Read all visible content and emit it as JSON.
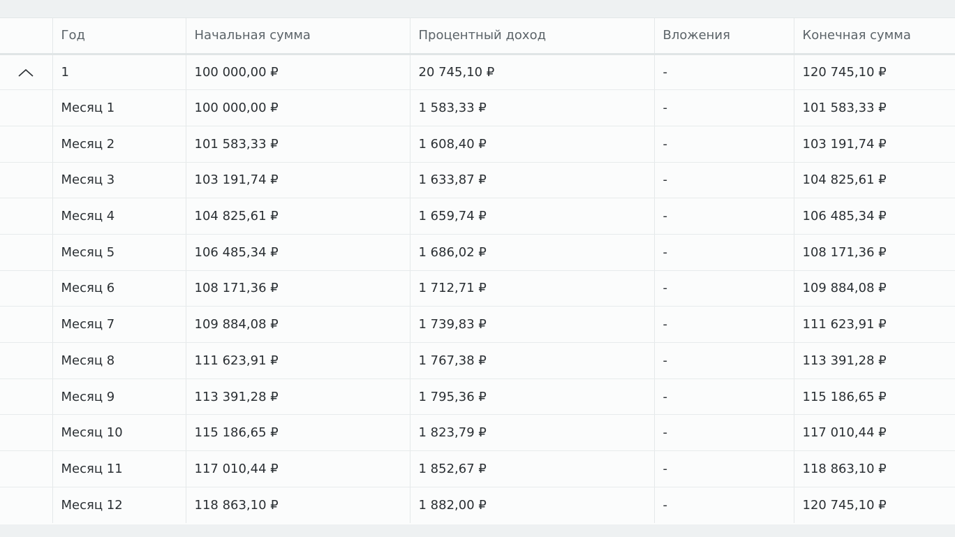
{
  "table": {
    "headers": [
      "",
      "Год",
      "Начальная сумма",
      "Процентный доход",
      "Вложения",
      "Конечная сумма"
    ],
    "year_row": {
      "year": "1",
      "start": "100 000,00 ₽",
      "interest": "20 745,10 ₽",
      "deposits": "-",
      "end": "120 745,10 ₽",
      "toggle_icon": "chevron-up-icon"
    },
    "months": [
      {
        "label": "Месяц 1",
        "start": "100 000,00 ₽",
        "interest": "1 583,33 ₽",
        "deposits": "-",
        "end": "101 583,33 ₽"
      },
      {
        "label": "Месяц 2",
        "start": "101 583,33 ₽",
        "interest": "1 608,40 ₽",
        "deposits": "-",
        "end": "103 191,74 ₽"
      },
      {
        "label": "Месяц 3",
        "start": "103 191,74 ₽",
        "interest": "1 633,87 ₽",
        "deposits": "-",
        "end": "104 825,61 ₽"
      },
      {
        "label": "Месяц 4",
        "start": "104 825,61 ₽",
        "interest": "1 659,74 ₽",
        "deposits": "-",
        "end": "106 485,34 ₽"
      },
      {
        "label": "Месяц 5",
        "start": "106 485,34 ₽",
        "interest": "1 686,02 ₽",
        "deposits": "-",
        "end": "108 171,36 ₽"
      },
      {
        "label": "Месяц 6",
        "start": "108 171,36 ₽",
        "interest": "1 712,71 ₽",
        "deposits": "-",
        "end": "109 884,08 ₽"
      },
      {
        "label": "Месяц 7",
        "start": "109 884,08 ₽",
        "interest": "1 739,83 ₽",
        "deposits": "-",
        "end": "111 623,91 ₽"
      },
      {
        "label": "Месяц 8",
        "start": "111 623,91 ₽",
        "interest": "1 767,38 ₽",
        "deposits": "-",
        "end": "113 391,28 ₽"
      },
      {
        "label": "Месяц 9",
        "start": "113 391,28 ₽",
        "interest": "1 795,36 ₽",
        "deposits": "-",
        "end": "115 186,65 ₽"
      },
      {
        "label": "Месяц 10",
        "start": "115 186,65 ₽",
        "interest": "1 823,79 ₽",
        "deposits": "-",
        "end": "117 010,44 ₽"
      },
      {
        "label": "Месяц 11",
        "start": "117 010,44 ₽",
        "interest": "1 852,67 ₽",
        "deposits": "-",
        "end": "118 863,10 ₽"
      },
      {
        "label": "Месяц 12",
        "start": "118 863,10 ₽",
        "interest": "1 882,00 ₽",
        "deposits": "-",
        "end": "120 745,10 ₽"
      }
    ]
  }
}
